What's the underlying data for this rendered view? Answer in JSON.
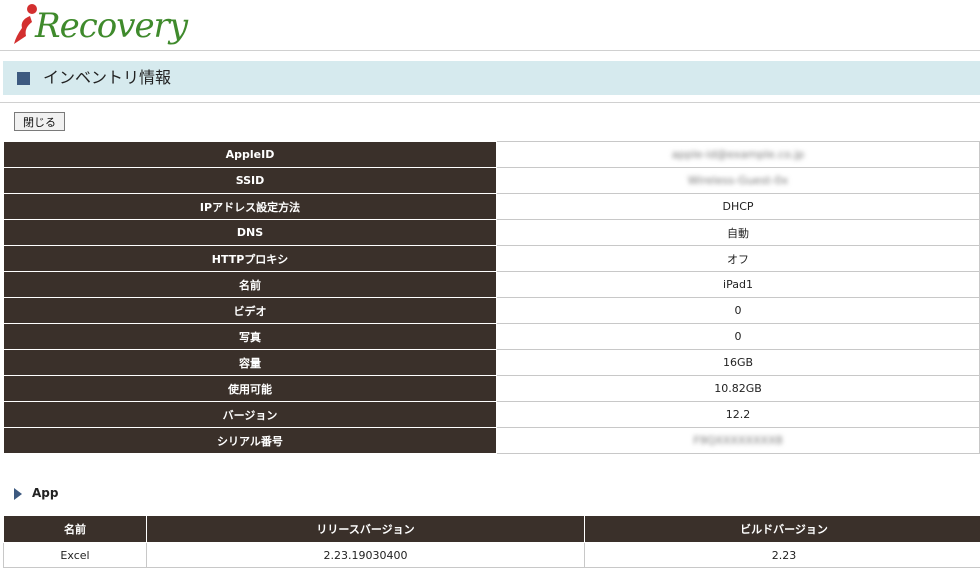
{
  "logo": {
    "text": "Recovery",
    "i_color": "#d32f2f",
    "text_color": "#3f8a2c"
  },
  "title": {
    "text": "インベントリ情報"
  },
  "close_button": {
    "label": "閉じる"
  },
  "info_rows": [
    {
      "key": "AppleID",
      "value": "apple-id@example.co.jp",
      "blurred": true
    },
    {
      "key": "SSID",
      "value": "Wireless-Guest-0x",
      "blurred": true
    },
    {
      "key": "IPアドレス設定方法",
      "value": "DHCP",
      "blurred": false
    },
    {
      "key": "DNS",
      "value": "自動",
      "blurred": false
    },
    {
      "key": "HTTPプロキシ",
      "value": "オフ",
      "blurred": false
    },
    {
      "key": "名前",
      "value": "iPad1",
      "blurred": false
    },
    {
      "key": "ビデオ",
      "value": "0",
      "blurred": false
    },
    {
      "key": "写真",
      "value": "0",
      "blurred": false
    },
    {
      "key": "容量",
      "value": "16GB",
      "blurred": false
    },
    {
      "key": "使用可能",
      "value": "10.82GB",
      "blurred": false
    },
    {
      "key": "バージョン",
      "value": "12.2",
      "blurred": false
    },
    {
      "key": "シリアル番号",
      "value": "F9QXXXXXXXX8",
      "blurred": true
    }
  ],
  "app_section": {
    "title": "App"
  },
  "app_table": {
    "headers": [
      "名前",
      "リリースバージョン",
      "ビルドバージョン"
    ],
    "rows": [
      [
        "Excel",
        "2.23.19030400",
        "2.23"
      ]
    ]
  },
  "colors": {
    "header_dark": "#3a302a",
    "title_bar": "#d6eaee",
    "accent": "#3d5a80"
  }
}
